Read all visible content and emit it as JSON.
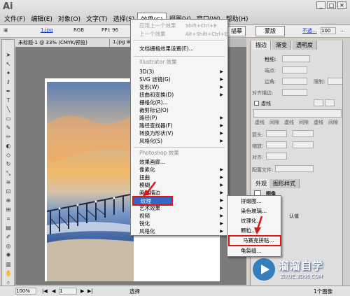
{
  "app": {
    "logo": "Ai",
    "window_controls": [
      "minimize",
      "restore",
      "close"
    ]
  },
  "menubar": {
    "items": [
      "文件(F)",
      "编辑(E)",
      "对象(O)",
      "文字(T)",
      "选择(S)",
      "效果(C)",
      "视图(V)",
      "窗口(W)",
      "帮助(H)"
    ]
  },
  "controlbar": {
    "file": "1.jpg",
    "mode": "RGB",
    "ppi": "PPI: 96",
    "trace_btn": "描摹",
    "mask_btn": "蒙版",
    "opacity_label": "不透...",
    "opacity_value": "100",
    "right_icon": "..."
  },
  "doctabs": [
    "未标题-1 @ 33% (CMYK/预览)",
    "1.jpg ⊗"
  ],
  "effect_menu": {
    "apply_last": "应用上一个效果",
    "apply_last_sc": "Shift+Ctrl+E",
    "last_effect": "上一个效果",
    "last_effect_sc": "Alt+Shift+Ctrl+E",
    "doc_raster": "文档栅格效果设置(E)...",
    "illustrator_header": "Illustrator 效果",
    "illustrator_items": [
      "3D(3)",
      "SVG 滤镜(G)",
      "变形(W)",
      "扭曲和变换(D)",
      "栅格化(R)...",
      "裁剪标记(O)",
      "路径(P)",
      "路径查找器(F)",
      "转换为形状(V)",
      "风格化(S)"
    ],
    "photoshop_header": "Photoshop 效果",
    "photoshop_items": [
      "效果画廊...",
      "像素化",
      "扭曲",
      "模糊",
      "画笔描边",
      "素描",
      "纹理",
      "艺术效果",
      "视频",
      "锐化",
      "风格化"
    ]
  },
  "texture_menu": {
    "items": [
      "拼缀图...",
      "染色玻璃...",
      "纹理化...",
      "颗粒...",
      "马赛克拼贴...",
      "龟裂缝..."
    ]
  },
  "right_panel": {
    "tabs": [
      "描边",
      "渐变",
      "透明度"
    ],
    "weight_label": "粗细:",
    "cap_label": "端点:",
    "corner_label": "边角:",
    "limit_label": "限制:",
    "align_label": "对齐描边:",
    "dashed_label": "虚线",
    "dash_labels": [
      "虚线",
      "间隙",
      "虚线",
      "间隙",
      "虚线",
      "间隙"
    ],
    "arrow_label": "箭头:",
    "scale_label": "缩放:",
    "align2_label": "对齐:",
    "profile_label": "配置文件:",
    "appearance_tabs": [
      "外观",
      "图形样式"
    ],
    "appearance_item": "图像",
    "default_label": "认值"
  },
  "statusbar": {
    "zoom": "100%",
    "page": "1",
    "mode": "选择",
    "object_count": "1个图像"
  },
  "watermark": {
    "brand": "溜溜自学",
    "url": "ZIXUE.3D66.COM"
  },
  "colors": {
    "highlight": "#3169c6",
    "annotation": "#e01515",
    "watermark_bg": "#1a6fb5"
  }
}
